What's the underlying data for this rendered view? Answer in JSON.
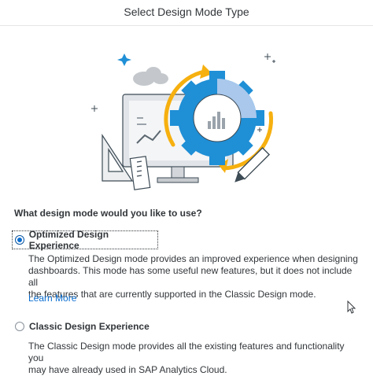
{
  "dialog": {
    "title": "Select Design Mode Type"
  },
  "illustration": {
    "icon": "design-mode-illustration-icon",
    "colors": {
      "gear": "#1f8fd6",
      "gear_pattern": "#a9c8ec",
      "arrow": "#f6b00f",
      "monitor": "#e1e4e8",
      "cloud": "#c4c8cc",
      "outline": "#3d4b55"
    }
  },
  "question": "What design mode would you like to use?",
  "options": [
    {
      "label": "Optimized Design Experience",
      "selected": true,
      "description": [
        "The Optimized Design mode provides an improved experience when designing",
        "dashboards. This mode has some useful new features, but it does not include all",
        "the features that are currently supported in the Classic Design mode."
      ],
      "link": "Learn More"
    },
    {
      "label": "Classic Design Experience",
      "selected": false,
      "description": [
        "The Classic Design mode provides all the existing features and functionality you",
        "may have already used in SAP Analytics Cloud."
      ]
    }
  ],
  "colors": {
    "accent": "#0a6ed1",
    "text": "#32363a"
  }
}
